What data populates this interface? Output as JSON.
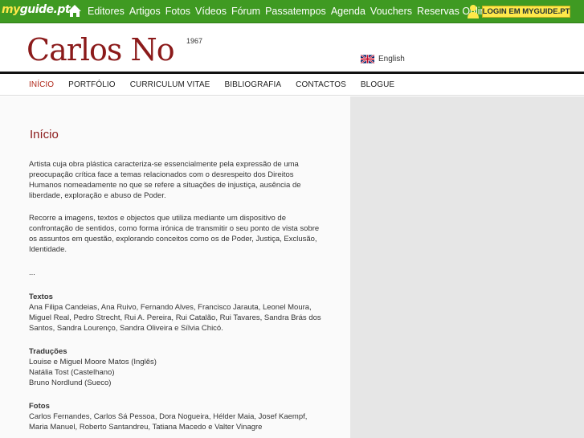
{
  "topbar": {
    "logo_prefix": "my",
    "logo_suffix": "guide.pt",
    "nav": [
      "Editores",
      "Artigos",
      "Fotos",
      "Vídeos",
      "Fórum",
      "Passatempos",
      "Agenda",
      "Vouchers",
      "Reservas Online"
    ],
    "login": "LOGIN EM MYGUIDE.PT"
  },
  "header": {
    "name": "Carlos No",
    "year": "1967",
    "lang": "English"
  },
  "secnav": [
    "INÍCIO",
    "PORTFÓLIO",
    "CURRICULUM VITAE",
    "BIBLIOGRAFIA",
    "CONTACTOS",
    "BLOGUE"
  ],
  "content": {
    "title": "Início",
    "p1": [
      "Artista cuja obra plástica caracteriza-se essencialmente pela expressão de uma",
      "preocupação crítica face a temas relacionados com o desrespeito dos Direitos",
      "Humanos nomeadamente no que se refere a situações de injustiça, ausência de",
      "liberdade, exploração e abuso de Poder."
    ],
    "p2": [
      "Recorre a imagens, textos e objectos que utiliza mediante um dispositivo de",
      "confrontação de sentidos, como forma irónica de transmitir o seu ponto de vista sobre",
      "os assuntos em questão, explorando conceitos como os de Poder, Justiça, Exclusão,",
      "Identidade."
    ],
    "ellipsis": "...",
    "textos_label": "Textos",
    "textos": [
      "Ana Filipa Candeias, Ana Ruivo, Fernando Alves, Francisco Jarauta, Leonel Moura,",
      "Miguel Real, Pedro Strecht, Rui A. Pereira, Rui Catalão, Rui Tavares, Sandra Brás dos",
      "Santos, Sandra Lourenço, Sandra Oliveira e Sílvia Chicó."
    ],
    "traducoes_label": "Traduções",
    "traducoes": [
      "Louise e Miguel Moore Matos (Inglês)",
      "Natália Tost (Castelhano)",
      "Bruno Nordlund (Sueco)"
    ],
    "fotos_label": "Fotos",
    "fotos": [
      "Carlos Fernandes, Carlos Sá Pessoa, Dora Nogueira, Hélder Maia, Josef Kaempf,",
      "Maria Manuel, Roberto Santandreu, Tatiana Macedo e Valter Vinagre"
    ]
  }
}
